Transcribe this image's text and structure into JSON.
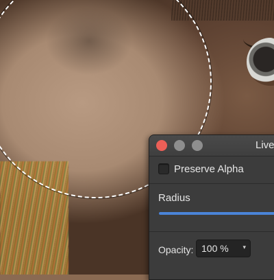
{
  "panel": {
    "title": "Live",
    "preserve_alpha": {
      "label": "Preserve Alpha",
      "checked": false
    },
    "radius": {
      "label": "Radius",
      "value_fraction": 1.0
    },
    "opacity": {
      "label": "Opacity:",
      "value": "100 %",
      "chevron_glyph": "▾"
    }
  },
  "colors": {
    "accent": "#4a84d8",
    "close_button": "#ec5f57",
    "panel_bg": "#3c3c3c"
  },
  "icons": [
    "close-window-icon",
    "minimize-window-icon",
    "maximize-window-icon",
    "chevron-down-icon"
  ]
}
